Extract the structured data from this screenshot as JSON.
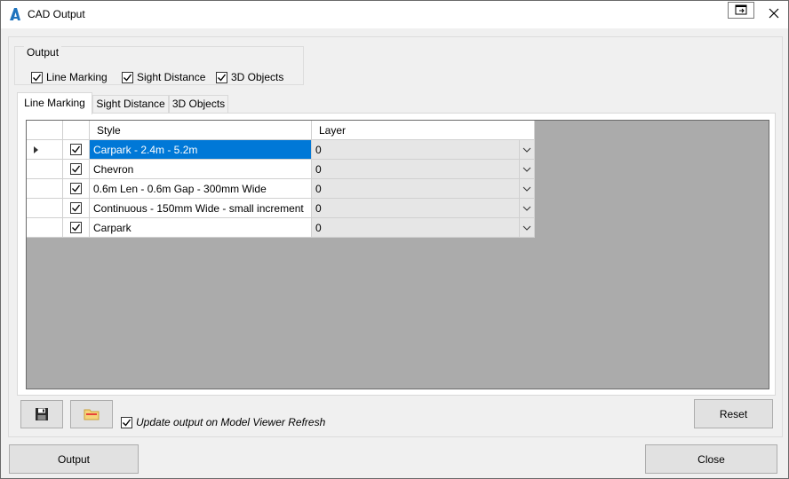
{
  "window": {
    "title": "CAD Output",
    "app_icon": "autodesk-a-icon",
    "restore_icon": "window-pin-icon",
    "close_icon": "close-icon"
  },
  "output_group": {
    "legend": "Output",
    "checkboxes": [
      {
        "label": "Line Marking",
        "checked": true
      },
      {
        "label": "Sight Distance",
        "checked": true
      },
      {
        "label": "3D Objects",
        "checked": true
      }
    ]
  },
  "tabs": [
    {
      "label": "Line Marking",
      "active": true
    },
    {
      "label": "Sight Distance",
      "active": false
    },
    {
      "label": "3D Objects",
      "active": false
    }
  ],
  "grid": {
    "columns": [
      "Style",
      "Layer"
    ],
    "rows": [
      {
        "checked": true,
        "style": "Carpark - 2.4m - 5.2m",
        "layer": "0",
        "selected": true
      },
      {
        "checked": true,
        "style": "Chevron",
        "layer": "0",
        "selected": false
      },
      {
        "checked": true,
        "style": "0.6m Len - 0.6m Gap - 300mm Wide",
        "layer": "0",
        "selected": false
      },
      {
        "checked": true,
        "style": "Continuous - 150mm Wide - small increment",
        "layer": "0",
        "selected": false
      },
      {
        "checked": true,
        "style": "Carpark",
        "layer": "0",
        "selected": false
      }
    ]
  },
  "bottom": {
    "save_icon": "floppy-disk-icon",
    "open_icon": "folder-icon",
    "update_label": "Update output on Model Viewer Refresh",
    "update_checked": true,
    "reset_label": "Reset"
  },
  "footer": {
    "output_label": "Output",
    "close_label": "Close"
  },
  "colors": {
    "selection": "#0078d7",
    "grid_background": "#ababab",
    "window_background": "#f0f0f0"
  }
}
